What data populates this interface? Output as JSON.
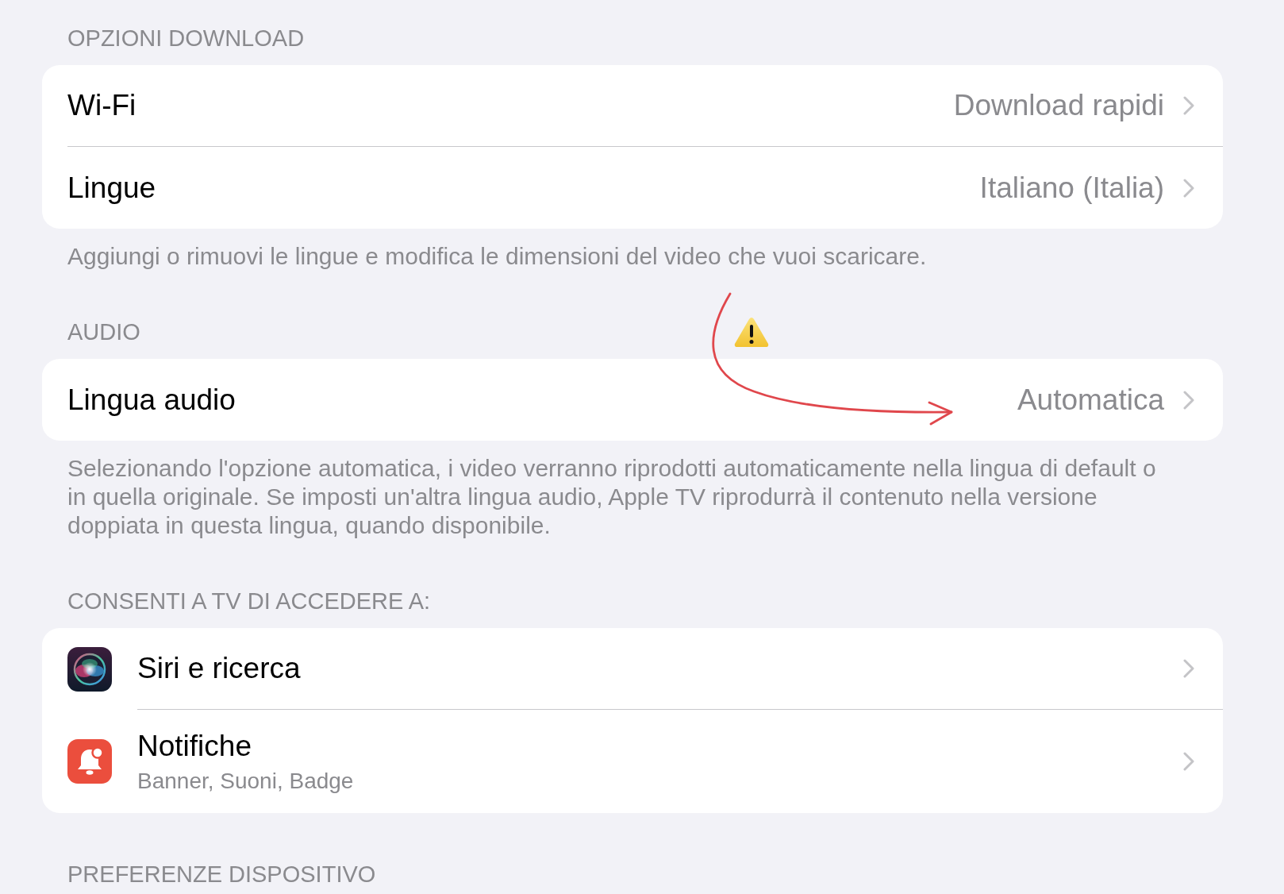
{
  "sections": [
    {
      "header": "OPZIONI DOWNLOAD",
      "rows": [
        {
          "label": "Wi-Fi",
          "value": "Download rapidi"
        },
        {
          "label": "Lingue",
          "value": "Italiano (Italia)"
        }
      ],
      "footer": "Aggiungi o rimuovi le lingue e modifica le dimensioni del video che vuoi scaricare."
    },
    {
      "header": "AUDIO",
      "rows": [
        {
          "label": "Lingua audio",
          "value": "Automatica"
        }
      ],
      "footer": "Selezionando l'opzione automatica, i video verranno riprodotti automaticamente nella lingua di default o in quella originale. Se imposti un'altra lingua audio, Apple TV riprodurrà il contenuto nella versione doppiata in questa lingua, quando disponibile."
    },
    {
      "header": "CONSENTI A TV DI ACCEDERE A:",
      "rows": [
        {
          "kind": "assistant",
          "label": "Siri e ricerca"
        },
        {
          "kind": "notifications",
          "label": "Notifiche",
          "subtitle": "Banner, Suoni, Badge"
        }
      ]
    },
    {
      "header": "PREFERENZE DISPOSITIVO"
    }
  ]
}
